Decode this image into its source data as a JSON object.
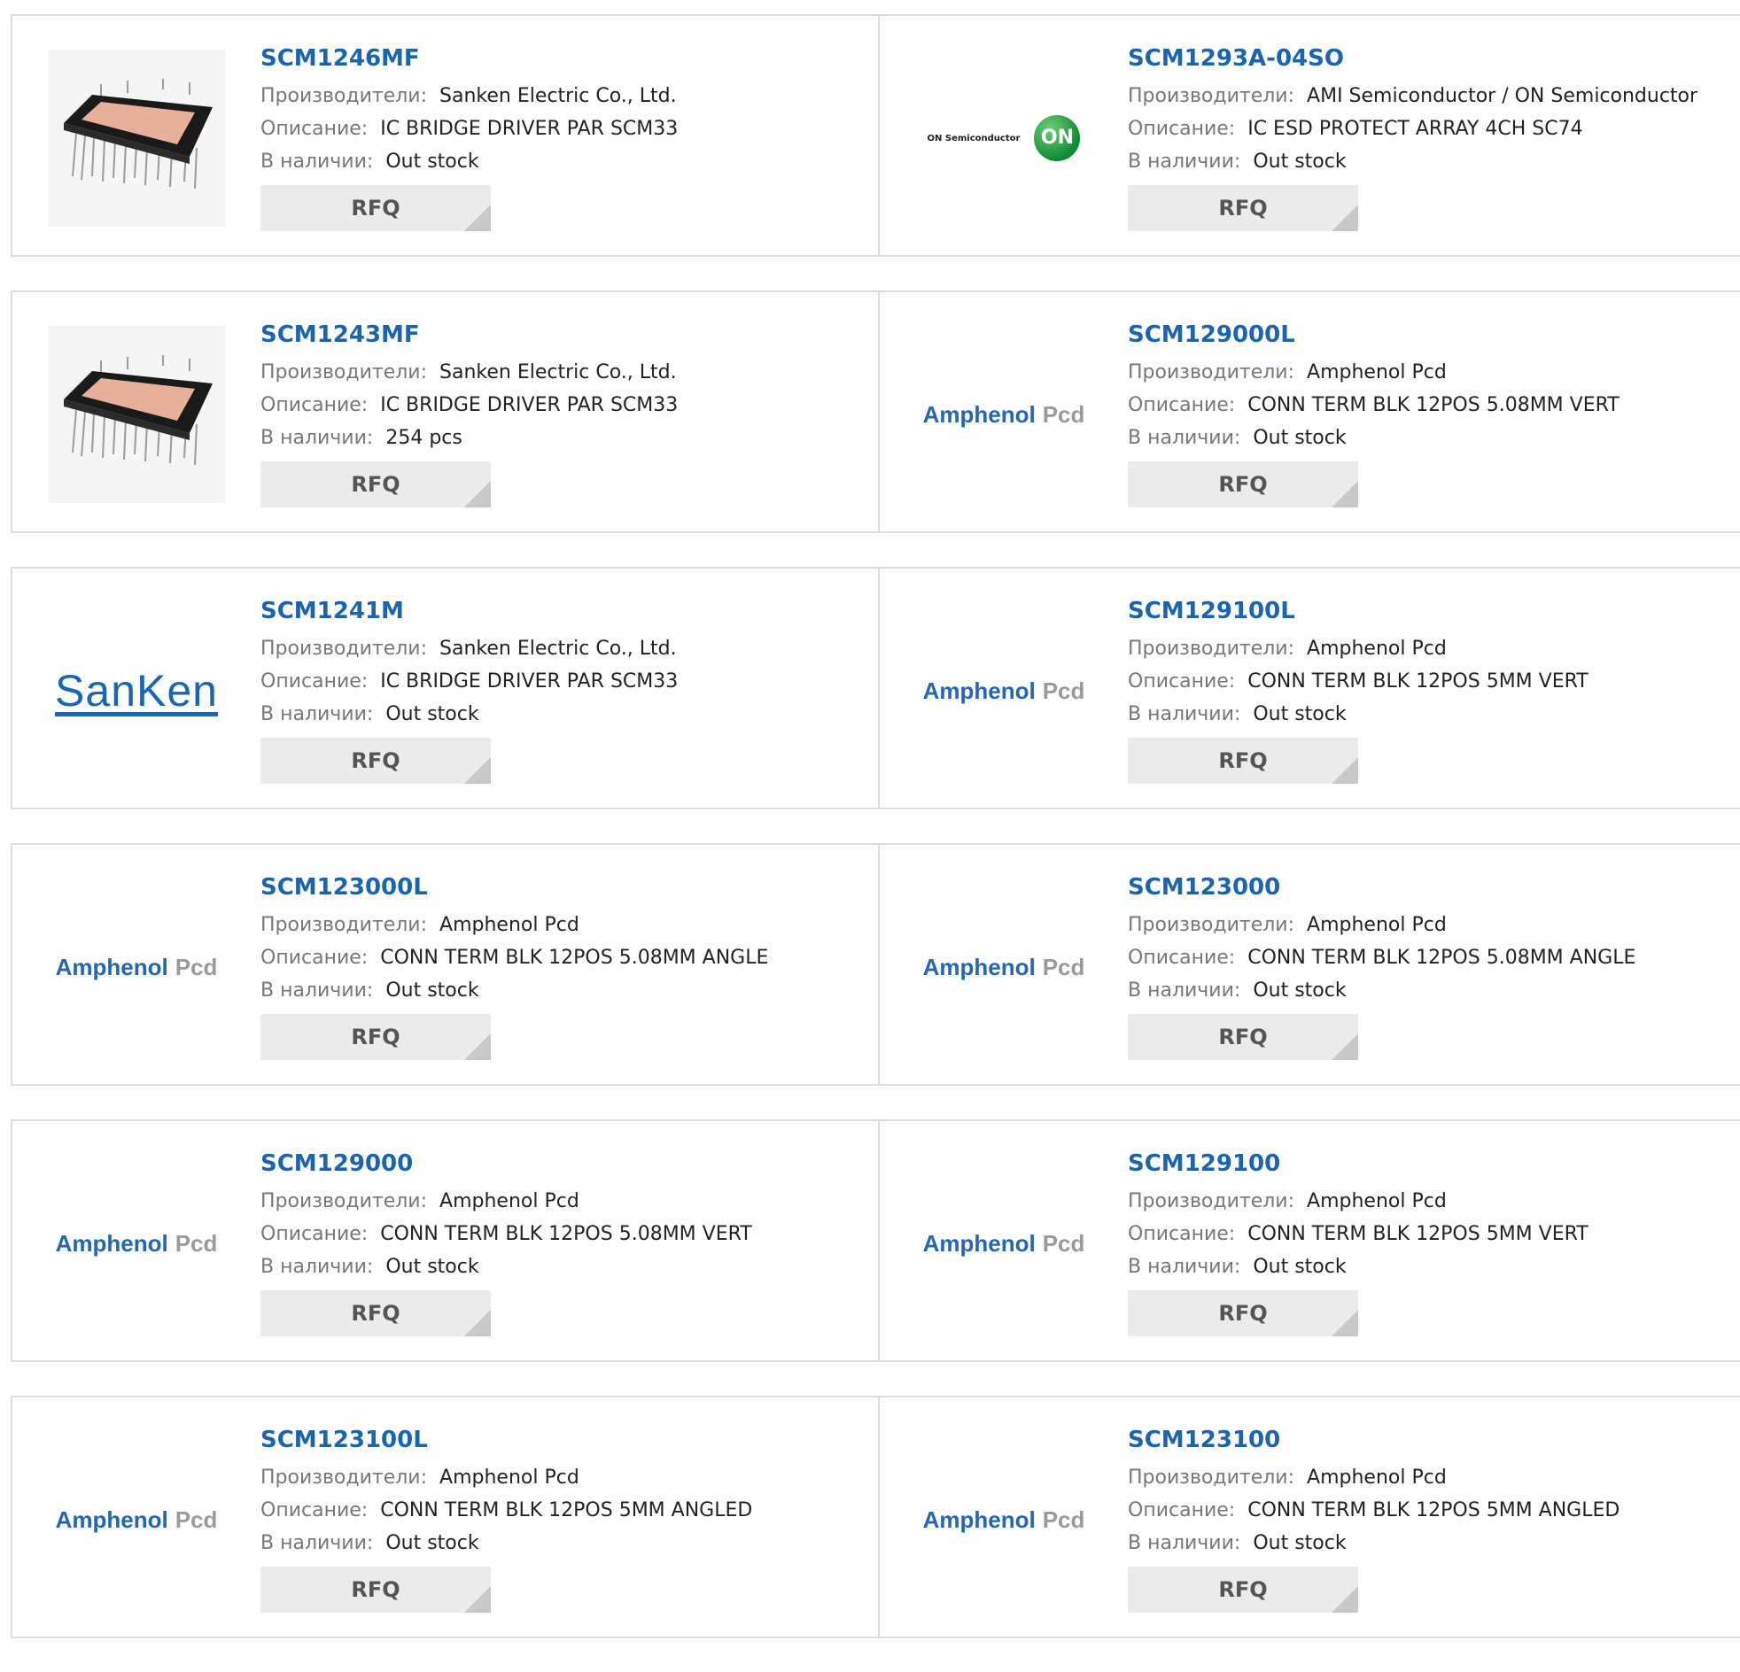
{
  "labels": {
    "manufacturer": "Производители:",
    "description": "Описание:",
    "stock": "В наличии:",
    "rfq": "RFQ"
  },
  "logos": {
    "amphenol_main": "Amphenol",
    "amphenol_sub": "Pcd",
    "sanken": "SanKen",
    "on_text": "ON Semiconductor",
    "on_mark": "ON"
  },
  "products": [
    {
      "part": "SCM1246MF",
      "manufacturer": "Sanken Electric Co., Ltd.",
      "description": "IC BRIDGE DRIVER PAR SCM33",
      "stock": "Out stock",
      "image": "module-photo"
    },
    {
      "part": "SCM1293A-04SO",
      "manufacturer": "AMI Semiconductor / ON Semiconductor",
      "description": "IC ESD PROTECT ARRAY 4CH SC74",
      "stock": "Out stock",
      "image": "on-semiconductor-logo"
    },
    {
      "part": "SCM1243MF",
      "manufacturer": "Sanken Electric Co., Ltd.",
      "description": "IC BRIDGE DRIVER PAR SCM33",
      "stock": "254 pcs",
      "image": "module-photo"
    },
    {
      "part": "SCM129000L",
      "manufacturer": "Amphenol Pcd",
      "description": "CONN TERM BLK 12POS 5.08MM VERT",
      "stock": "Out stock",
      "image": "amphenol-logo"
    },
    {
      "part": "SCM1241M",
      "manufacturer": "Sanken Electric Co., Ltd.",
      "description": "IC BRIDGE DRIVER PAR SCM33",
      "stock": "Out stock",
      "image": "sanken-logo"
    },
    {
      "part": "SCM129100L",
      "manufacturer": "Amphenol Pcd",
      "description": "CONN TERM BLK 12POS 5MM VERT",
      "stock": "Out stock",
      "image": "amphenol-logo"
    },
    {
      "part": "SCM123000L",
      "manufacturer": "Amphenol Pcd",
      "description": "CONN TERM BLK 12POS 5.08MM ANGLE",
      "stock": "Out stock",
      "image": "amphenol-logo"
    },
    {
      "part": "SCM123000",
      "manufacturer": "Amphenol Pcd",
      "description": "CONN TERM BLK 12POS 5.08MM ANGLE",
      "stock": "Out stock",
      "image": "amphenol-logo"
    },
    {
      "part": "SCM129000",
      "manufacturer": "Amphenol Pcd",
      "description": "CONN TERM BLK 12POS 5.08MM VERT",
      "stock": "Out stock",
      "image": "amphenol-logo"
    },
    {
      "part": "SCM129100",
      "manufacturer": "Amphenol Pcd",
      "description": "CONN TERM BLK 12POS 5MM VERT",
      "stock": "Out stock",
      "image": "amphenol-logo"
    },
    {
      "part": "SCM123100L",
      "manufacturer": "Amphenol Pcd",
      "description": "CONN TERM BLK 12POS 5MM ANGLED",
      "stock": "Out stock",
      "image": "amphenol-logo"
    },
    {
      "part": "SCM123100",
      "manufacturer": "Amphenol Pcd",
      "description": "CONN TERM BLK 12POS 5MM ANGLED",
      "stock": "Out stock",
      "image": "amphenol-logo"
    }
  ]
}
